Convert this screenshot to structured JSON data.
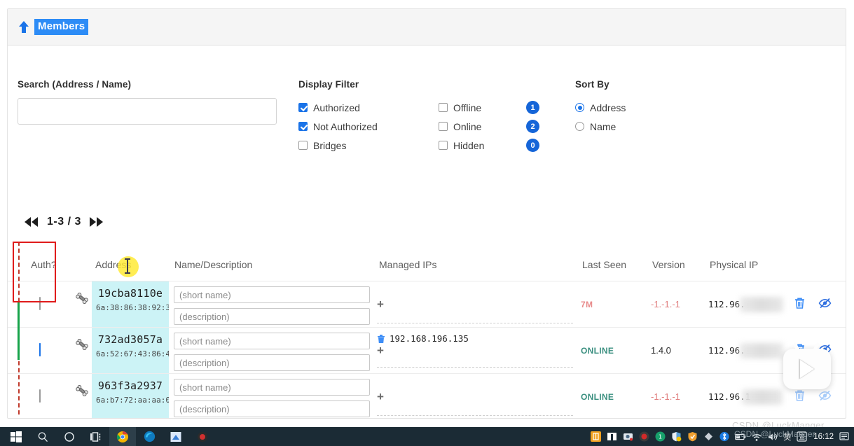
{
  "header": {
    "title": "Members",
    "up_arrow_icon": "arrow-up-icon"
  },
  "search": {
    "label": "Search (Address / Name)",
    "value": "",
    "placeholder": ""
  },
  "display_filter": {
    "label": "Display Filter",
    "options_left": [
      {
        "label": "Authorized",
        "checked": true
      },
      {
        "label": "Not Authorized",
        "checked": true
      },
      {
        "label": "Bridges",
        "checked": false
      }
    ],
    "options_right": [
      {
        "label": "Offline",
        "checked": false,
        "count": "1"
      },
      {
        "label": "Online",
        "checked": false,
        "count": "2"
      },
      {
        "label": "Hidden",
        "checked": false,
        "count": "0"
      }
    ]
  },
  "sort_by": {
    "label": "Sort By",
    "options": [
      {
        "label": "Address",
        "selected": true
      },
      {
        "label": "Name",
        "selected": false
      }
    ]
  },
  "pagination": {
    "first_icon": "skip-back-icon",
    "range": "1-3 / 3",
    "last_icon": "skip-forward-icon"
  },
  "table": {
    "columns": {
      "auth": "Auth?",
      "address": "Address",
      "name_description": "Name/Description",
      "managed_ips": "Managed IPs",
      "last_seen": "Last Seen",
      "version": "Version",
      "physical_ip": "Physical IP"
    },
    "placeholders": {
      "short_name": "(short name)",
      "description": "(description)"
    },
    "add_ip_label": "+",
    "rows": [
      {
        "authorized": false,
        "pin_icon": "bone-icon",
        "address": "19cba8110e",
        "mac": "6a:38:86:38:92:3",
        "short_name": "",
        "description": "",
        "managed_ips": [],
        "last_seen": "7M",
        "last_seen_state": "offline",
        "version": "-1.-1.-1",
        "version_state": "unknown",
        "physical_ip": "112.96.",
        "delete_icon": "trash-icon",
        "hide_icon": "eye-slash-icon"
      },
      {
        "authorized": true,
        "pin_icon": "bone-icon",
        "address": "732ad3057a",
        "mac": "6a:52:67:43:86:4",
        "short_name": "",
        "description": "",
        "managed_ips": [
          "192.168.196.135"
        ],
        "last_seen": "ONLINE",
        "last_seen_state": "online",
        "version": "1.4.0",
        "version_state": "known",
        "physical_ip": "112.96.",
        "delete_icon": "trash-icon",
        "hide_icon": "eye-slash-icon"
      },
      {
        "authorized": false,
        "pin_icon": "bone-icon",
        "address": "963f3a2937",
        "mac": "6a:b7:72:aa:aa:0",
        "short_name": "",
        "description": "",
        "managed_ips": [],
        "last_seen": "ONLINE",
        "last_seen_state": "online",
        "version": "-1.-1.-1",
        "version_state": "unknown",
        "physical_ip": "112.96.1",
        "delete_icon": "trash-icon",
        "hide_icon": "eye-slash-icon"
      }
    ]
  },
  "taskbar": {
    "start_icon": "windows-start-icon",
    "search_icon": "search-icon",
    "cortana_icon": "cortana-circle-icon",
    "taskview_icon": "task-view-icon",
    "chrome_icon": "chrome-icon",
    "edge_icon": "edge-icon",
    "folder_icon": "app-icon",
    "record_icon": "record-icon",
    "ime_label": "英",
    "ime_box_label": "箮",
    "clock": "16:12",
    "watermark": "CSDN @LuckManger"
  },
  "colors": {
    "accent": "#1a73e8",
    "title_highlight": "#2d8cf6",
    "address_cell": "#ccf3f6",
    "online": "#3a8f7f",
    "offline": "#e88a8a",
    "version_unknown": "#e07d7d",
    "annotation_red": "#e01b1b",
    "annotation_green": "#16a34a",
    "click_highlight": "#ffe92e"
  }
}
